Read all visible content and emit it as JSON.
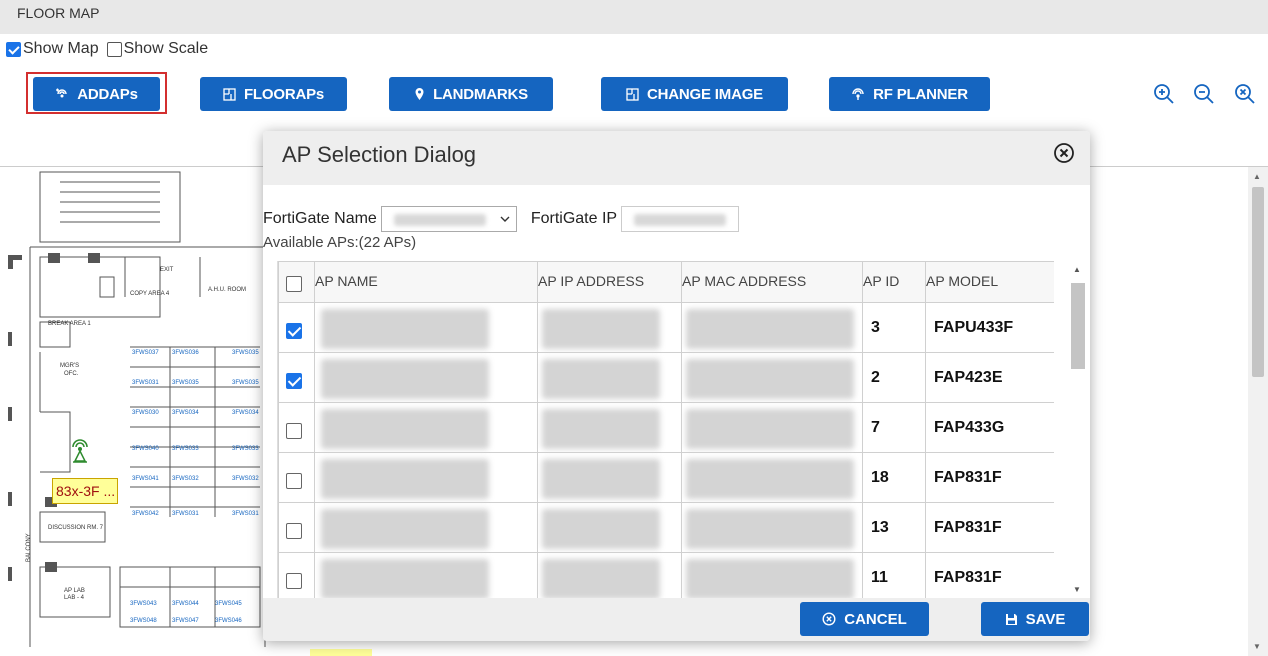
{
  "header": {
    "title": "FLOOR MAP"
  },
  "options": {
    "show_map": "Show Map",
    "show_scale": "Show Scale",
    "show_map_checked": true,
    "show_scale_checked": false
  },
  "toolbar": {
    "addaps": "ADDAPs",
    "floor_aps": "FLOORAPs",
    "landmarks": "LANDMARKS",
    "change_image": "CHANGE IMAGE",
    "rf_planner": "RF PLANNER"
  },
  "map": {
    "ap_label": "83x-3F ...",
    "rooms": [
      "COPY AREA 4",
      "A.H.U. ROOM",
      "BREAK AREA 1",
      "MGR'S OFC.",
      "DISCUSSION RM. 7",
      "AP LAB LAB - 4",
      "BALCONY",
      "EXIT"
    ],
    "desks": [
      "3FWS037",
      "3FWS036",
      "3FWS035",
      "3FWS031",
      "3FWS030",
      "3FWS034",
      "3FWS040",
      "3FWS033",
      "3FWS041",
      "3FWS032",
      "3FWS042",
      "3FWS031",
      "3FWS043",
      "3FWS044",
      "3FWS045",
      "3FWS048",
      "3FWS047",
      "3FWS046"
    ]
  },
  "dialog": {
    "title": "AP Selection Dialog",
    "fortigate_name_label": "FortiGate Name",
    "fortigate_ip_label": "FortiGate IP",
    "available": "Available APs:(22 APs)",
    "columns": {
      "ap_name": "AP NAME",
      "ap_ip": "AP IP ADDRESS",
      "ap_mac": "AP MAC ADDRESS",
      "ap_id": "AP ID",
      "ap_model": "AP MODEL"
    },
    "rows": [
      {
        "checked": true,
        "ap_id": "3",
        "ap_model": "FAPU433F"
      },
      {
        "checked": true,
        "ap_id": "2",
        "ap_model": "FAP423E"
      },
      {
        "checked": false,
        "ap_id": "7",
        "ap_model": "FAP433G"
      },
      {
        "checked": false,
        "ap_id": "18",
        "ap_model": "FAP831F"
      },
      {
        "checked": false,
        "ap_id": "13",
        "ap_model": "FAP831F"
      },
      {
        "checked": false,
        "ap_id": "11",
        "ap_model": "FAP831F"
      }
    ],
    "cancel": "CANCEL",
    "save": "SAVE"
  },
  "colors": {
    "accent": "#1565c0",
    "highlight": "#d32f2f",
    "checkbox": "#1a73e8"
  }
}
